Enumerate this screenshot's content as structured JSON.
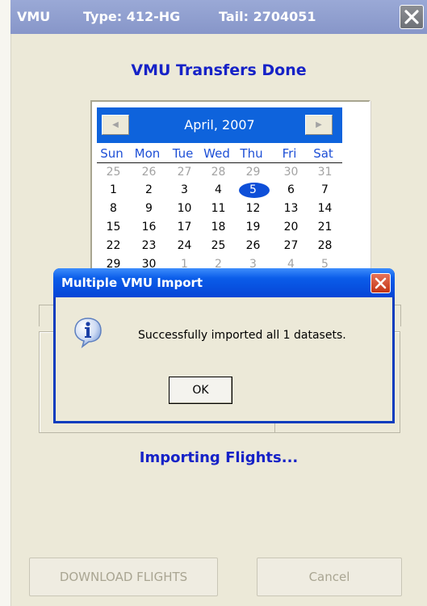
{
  "titlebar": {
    "app": "VMU",
    "type": "Type: 412-HG",
    "tail": "Tail: 2704051"
  },
  "heading": "VMU Transfers Done",
  "calendar": {
    "month_label": "April, 2007",
    "weekdays": [
      "Sun",
      "Mon",
      "Tue",
      "Wed",
      "Thu",
      "Fri",
      "Sat"
    ],
    "weeks": [
      [
        "25",
        "26",
        "27",
        "28",
        "29",
        "30",
        "31"
      ],
      [
        "1",
        "2",
        "3",
        "4",
        "5",
        "6",
        "7"
      ],
      [
        "8",
        "9",
        "10",
        "11",
        "12",
        "13",
        "14"
      ],
      [
        "15",
        "16",
        "17",
        "18",
        "19",
        "20",
        "21"
      ],
      [
        "22",
        "23",
        "24",
        "25",
        "26",
        "27",
        "28"
      ],
      [
        "29",
        "30",
        "1",
        "2",
        "3",
        "4",
        "5"
      ]
    ],
    "selected_day": "5",
    "selected_color": "#0e4fd8",
    "header_color": "#0e63dc"
  },
  "status_text": "Importing Flights...",
  "buttons": {
    "download": "DOWNLOAD FLIGHTS",
    "cancel": "Cancel"
  },
  "dialog": {
    "title": "Multiple VMU Import",
    "message": "Successfully imported all 1 datasets.",
    "ok_label": "OK",
    "icon": "info-icon"
  },
  "colors": {
    "heading": "#1622c7",
    "dialog_title": "#0a5ce9",
    "disabled_text": "#a9a592"
  }
}
